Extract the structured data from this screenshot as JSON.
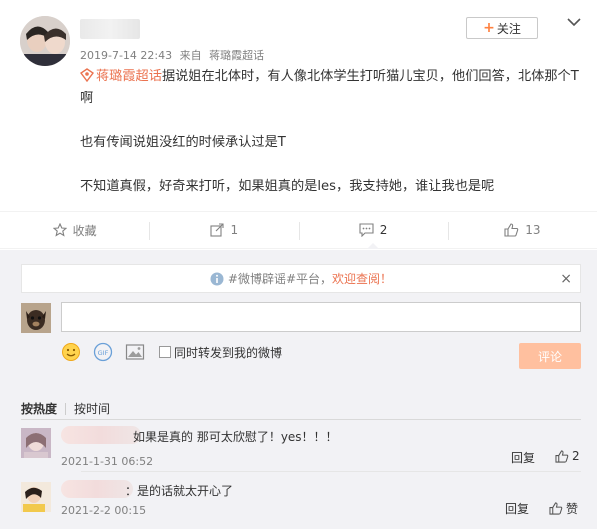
{
  "post": {
    "timestamp": "2019-7-14 22:43",
    "source_prefix": "来自",
    "source": "蒋璐霞超话",
    "follow_label": "关注",
    "topic": "蒋璐霞超话",
    "line1": "据说姐在北体时，有人像北体学生打听猫儿宝贝，他们回答，北体那个T啊",
    "line2": "也有传闻说姐没红的时候承认过是T",
    "line3": "不知道真假，好奇来打听，如果姐真的是les，我支持她，谁让我也是呢"
  },
  "actions": [
    {
      "icon": "star-icon",
      "label": "收藏"
    },
    {
      "icon": "forward-icon",
      "label": "1"
    },
    {
      "icon": "comment-icon",
      "label": "2"
    },
    {
      "icon": "like-icon",
      "label": "13"
    }
  ],
  "notice": {
    "text": "#微博辟谣#平台，",
    "link": "欢迎查阅！",
    "close": "×"
  },
  "composer": {
    "placeholder": "",
    "forward_label": "同时转发到我的微博",
    "submit_label": "评论",
    "gif_label": "GIF"
  },
  "sort": {
    "hot": "按热度",
    "time": "按时间"
  },
  "comments": [
    {
      "text": "如果是真的 那可太欣慰了！yes！！！",
      "time": "2021-1-31 06:52",
      "reply": "回复",
      "likes": "2"
    },
    {
      "text": "：是的话就太开心了",
      "time": "2021-2-2 00:15",
      "reply": "回复",
      "likes": "赞"
    }
  ],
  "colors": {
    "accent": "#eb7350",
    "follow_plus": "#ff8140",
    "submit_disabled": "#ffc09f",
    "panel_bg": "#f2f2f5"
  }
}
